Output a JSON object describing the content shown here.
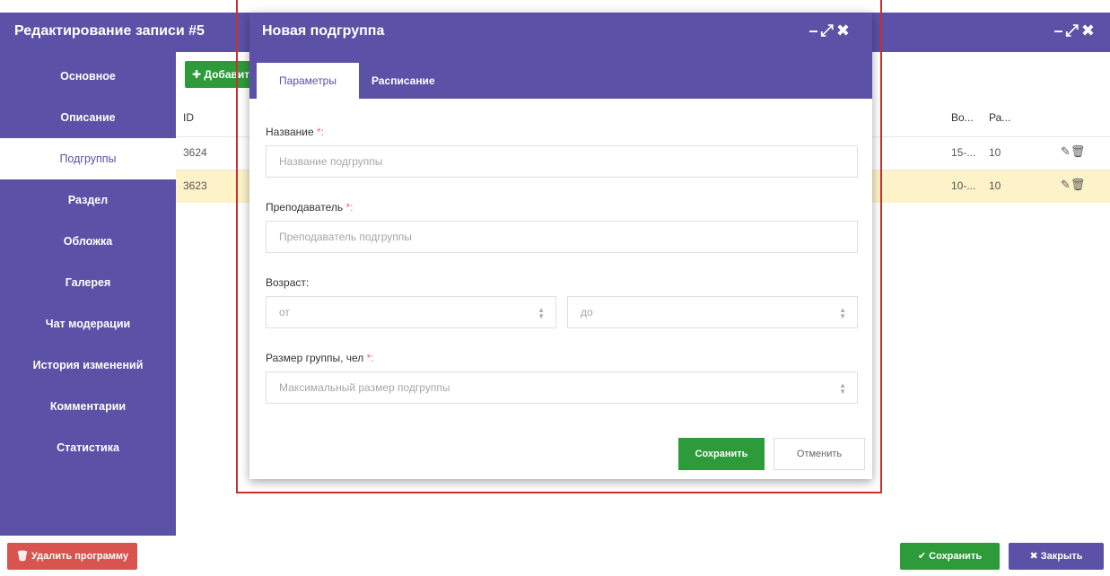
{
  "main_window": {
    "title": "Редактирование записи #5",
    "controls": "–⤢✖"
  },
  "sidebar": {
    "items": [
      {
        "label": "Основное"
      },
      {
        "label": "Описание"
      },
      {
        "label": "Подгруппы"
      },
      {
        "label": "Раздел"
      },
      {
        "label": "Обложка"
      },
      {
        "label": "Галерея"
      },
      {
        "label": "Чат модерации"
      },
      {
        "label": "История изменений"
      },
      {
        "label": "Комментарии"
      },
      {
        "label": "Статистика"
      }
    ],
    "active": "Подгруппы"
  },
  "content": {
    "add_button": "✚ Добавить",
    "columns": {
      "id": "ID",
      "age": "Во...",
      "size": "Ра..."
    },
    "rows": [
      {
        "id": "3624",
        "age": "15-...",
        "size": "10",
        "actions": "✎🗑"
      },
      {
        "id": "3623",
        "age": "10-...",
        "size": "10",
        "actions": "✎🗑"
      }
    ]
  },
  "bottom": {
    "delete_label": "🗑 Удалить программу",
    "save_label": "✔ Сохранить",
    "close_label": "✖ Закрыть"
  },
  "modal": {
    "title": "Новая подгруппа",
    "controls": "–⤢✖",
    "tabs": [
      {
        "label": "Параметры"
      },
      {
        "label": "Расписание"
      }
    ],
    "fields": {
      "name": {
        "label": "Название",
        "req": "*:",
        "placeholder": "Название подгруппы"
      },
      "teacher": {
        "label": "Преподаватель",
        "req": "*:",
        "placeholder": "Преподаватель подгруппы"
      },
      "age": {
        "label": "Возраст:",
        "from_placeholder": "от",
        "to_placeholder": "до"
      },
      "size": {
        "label": "Размер группы, чел",
        "req": "*:",
        "placeholder": "Максимальный размер подгруппы"
      }
    },
    "save_label": "Сохранить",
    "cancel_label": "Отменить"
  },
  "colors": {
    "brand": "#5b51a6",
    "success": "#2e9b3a",
    "danger": "#d9534f",
    "highlight_row": "#fdf2c8",
    "outline": "#c9302c"
  }
}
